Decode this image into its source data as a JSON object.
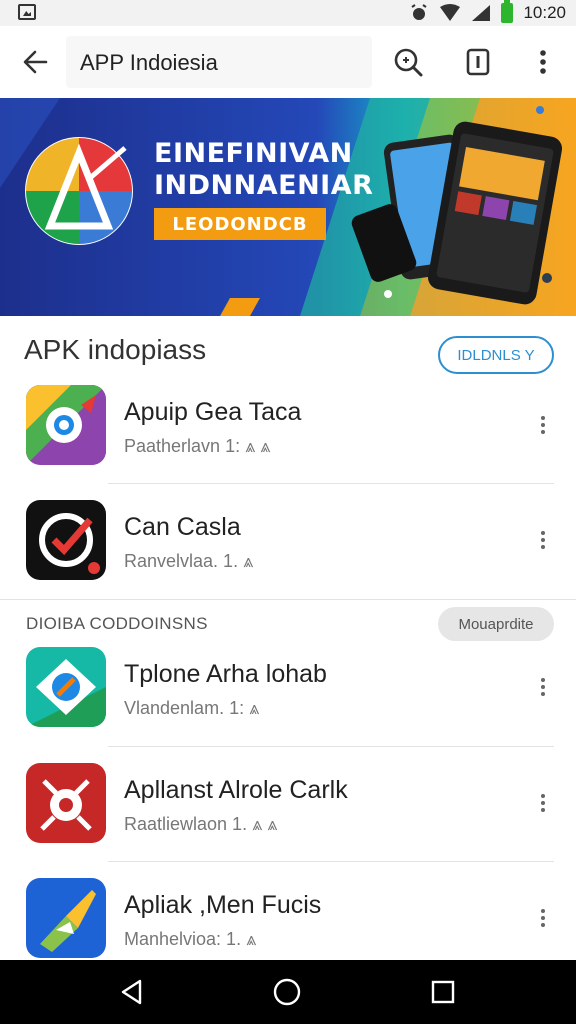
{
  "status_bar": {
    "time": "10:20"
  },
  "app_bar": {
    "title": "APP Indoiesia"
  },
  "banner": {
    "title_line1": "EINEFINIVAN",
    "title_line2": "INDNNAENIAR",
    "tag": "LEODONDCB"
  },
  "section1": {
    "title": "APK indopiass",
    "button": "IDLDNLS Y"
  },
  "apps": [
    {
      "name": "Apuip Gea Taca",
      "subtitle": "Paatherlavn 1: ⩓ ⩓"
    },
    {
      "name": "Can Casla",
      "subtitle": "Ranvelvlaa. 1. ⩓"
    },
    {
      "name": "Tplone Arha lohab",
      "subtitle": "Vlandenlam. 1: ⩓"
    },
    {
      "name": "Apllanst Alrole Carlk",
      "subtitle": "Raatliewlaon 1. ⩓ ⩓"
    },
    {
      "name": "Apliak ,Men Fucis",
      "subtitle": "Manhelvioa: 1. ⩓"
    }
  ],
  "section2": {
    "title": "DIOIBA CODDOINSNS",
    "button": "Mouaprdite"
  },
  "colors": {
    "accent": "#2d8fd0",
    "banner_blue": "#1f3c9e",
    "banner_orange": "#f39c12"
  }
}
